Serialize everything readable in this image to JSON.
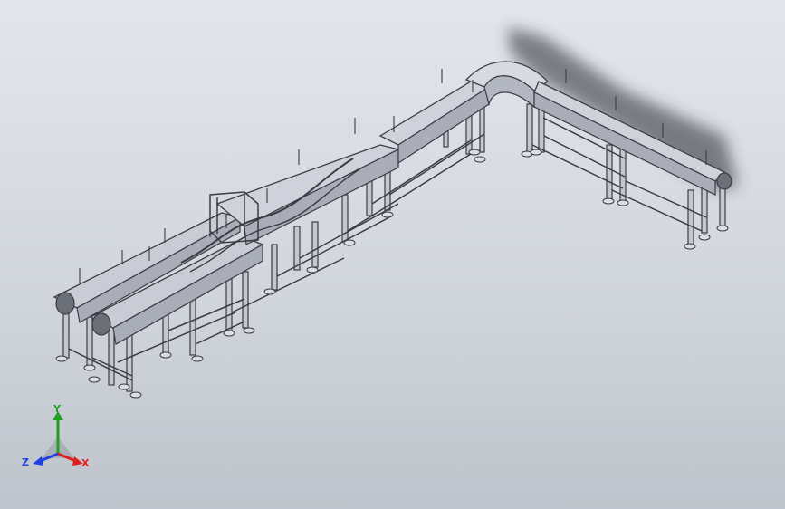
{
  "app": {
    "view": "isometric",
    "background_top": "#e3e6eb",
    "background_bottom": "#bfc4cc",
    "model_line_color": "#3a3d44",
    "model_fill_color": "#b9bcc7"
  },
  "triad": {
    "x_label": "X",
    "y_label": "Y",
    "z_label": "Z",
    "x_color": "#e02020",
    "y_color": "#20a020",
    "z_color": "#2040e0"
  }
}
